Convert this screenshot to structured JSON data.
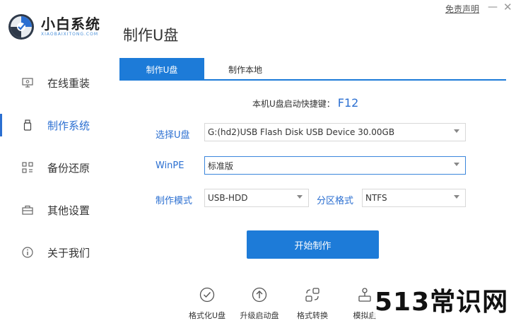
{
  "app": {
    "brand_name": "小白系统",
    "brand_sub": "XIAOBAIXITONG.COM",
    "page_title": "制作U盘",
    "disclaimer": "免责声明",
    "minimize_glyph": "—",
    "close_glyph": "✕"
  },
  "sidebar": {
    "items": [
      {
        "label": "在线重装",
        "icon": "monitor-icon",
        "active": false
      },
      {
        "label": "制作系统",
        "icon": "usb-drive-icon",
        "active": true
      },
      {
        "label": "备份还原",
        "icon": "backup-grid-icon",
        "active": false
      },
      {
        "label": "其他设置",
        "icon": "toolbox-icon",
        "active": false
      },
      {
        "label": "关于我们",
        "icon": "info-icon",
        "active": false
      }
    ]
  },
  "tabs": [
    {
      "label": "制作U盘",
      "active": true
    },
    {
      "label": "制作本地",
      "active": false
    }
  ],
  "hotkey": {
    "text": "本机U盘启动快捷键：",
    "key": "F12"
  },
  "form": {
    "usb_label": "选择U盘",
    "usb_value": "G:(hd2)USB Flash Disk USB Device 30.00GB",
    "winpe_label": "WinPE",
    "winpe_value": "标准版",
    "mode_label": "制作模式",
    "mode_value": "USB-HDD",
    "partition_label": "分区格式",
    "partition_value": "NTFS"
  },
  "start_button": "开始制作",
  "tools": [
    {
      "label": "格式化U盘",
      "icon": "check-circle-icon"
    },
    {
      "label": "升级启动盘",
      "icon": "upgrade-arrow-icon"
    },
    {
      "label": "格式转换",
      "icon": "convert-icon"
    },
    {
      "label": "模拟启",
      "icon": "simulate-icon"
    }
  ],
  "watermark": "513常识网",
  "colors": {
    "accent": "#1d7bd8",
    "label_blue": "#2b6fd1"
  }
}
